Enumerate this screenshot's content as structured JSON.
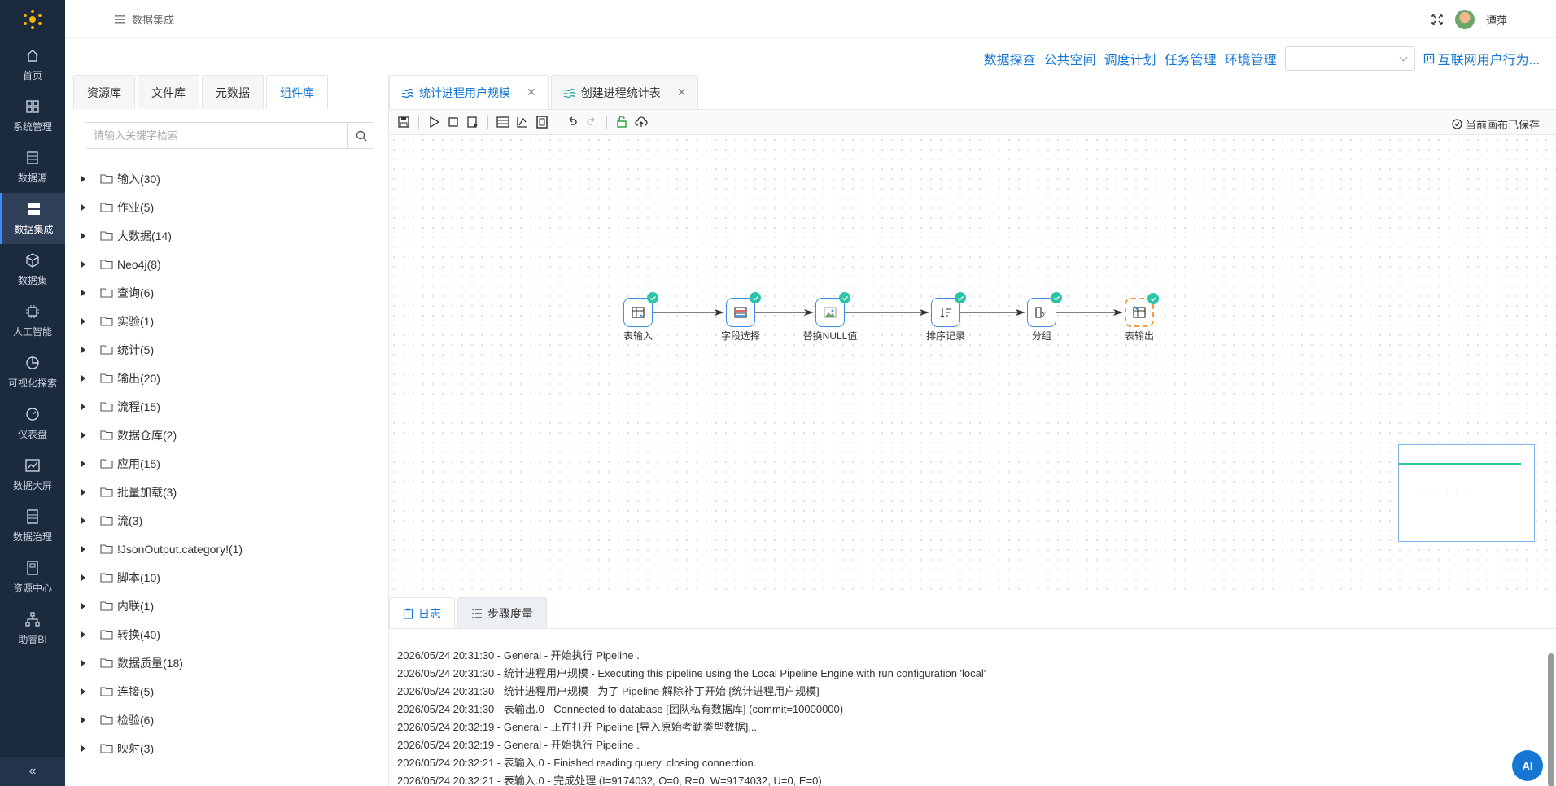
{
  "nav": {
    "items": [
      {
        "label": "首页",
        "icon": "home-icon"
      },
      {
        "label": "系统管理",
        "icon": "grid-icon"
      },
      {
        "label": "数据源",
        "icon": "database-icon"
      },
      {
        "label": "数据集成",
        "icon": "server-icon"
      },
      {
        "label": "数据集",
        "icon": "cube-icon"
      },
      {
        "label": "人工智能",
        "icon": "ai-icon"
      },
      {
        "label": "可视化探索",
        "icon": "pie-chart-icon"
      },
      {
        "label": "仪表盘",
        "icon": "gauge-icon"
      },
      {
        "label": "数据大屏",
        "icon": "line-chart-icon"
      },
      {
        "label": "数据治理",
        "icon": "book-icon"
      },
      {
        "label": "资源中心",
        "icon": "folder-icon"
      },
      {
        "label": "助睿BI",
        "icon": "org-chart-icon"
      }
    ],
    "collapse": "«"
  },
  "header": {
    "breadcrumb": "数据集成",
    "username": "谭萍"
  },
  "toplinks": {
    "items": [
      "数据探查",
      "公共空间",
      "调度计划",
      "任务管理",
      "环境管理"
    ],
    "select_value": "",
    "project": "互联网用户行为..."
  },
  "lpanel": {
    "tabs": [
      "资源库",
      "文件库",
      "元数据",
      "组件库"
    ],
    "search_placeholder": "请输入关键字检索",
    "tree": [
      "输入(30)",
      "作业(5)",
      "大数据(14)",
      "Neo4j(8)",
      "查询(6)",
      "实验(1)",
      "统计(5)",
      "输出(20)",
      "流程(15)",
      "数据仓库(2)",
      "应用(15)",
      "批量加载(3)",
      "流(3)",
      "!JsonOutput.category!(1)",
      "脚本(10)",
      "内联(1)",
      "转换(40)",
      "数据质量(18)",
      "连接(5)",
      "检验(6)",
      "映射(3)"
    ]
  },
  "editor": {
    "tabs": [
      {
        "label": "统计进程用户规模",
        "close": "✕"
      },
      {
        "label": "创建进程统计表",
        "close": "✕"
      }
    ],
    "saved": "当前画布已保存"
  },
  "pipeline": {
    "nodes": [
      {
        "label": "表输入",
        "icon": "table-input-icon"
      },
      {
        "label": "字段选择",
        "icon": "field-select-icon"
      },
      {
        "label": "替换NULL值",
        "icon": "image-placeholder-icon"
      },
      {
        "label": "排序记录",
        "icon": "sort-icon"
      },
      {
        "label": "分组",
        "icon": "group-sum-icon"
      },
      {
        "label": "表输出",
        "icon": "table-output-icon"
      }
    ]
  },
  "bottom": {
    "tabs": [
      "日志",
      "步骤度量"
    ],
    "logs": [
      "2026/05/24 20:31:30 - General - 开始执行 Pipeline .",
      "2026/05/24 20:31:30 - 统计进程用户规模 - Executing this pipeline using the Local Pipeline Engine with run configuration 'local'",
      "2026/05/24 20:31:30 - 统计进程用户规模 - 为了 Pipeline 解除补丁开始 [统计进程用户规模]",
      "2026/05/24 20:31:30 - 表输出.0 - Connected to database [团队私有数据库] (commit=10000000)",
      "2026/05/24 20:32:19 - General - 正在打开 Pipeline [导入原始考勤类型数据]...",
      "2026/05/24 20:32:19 - General - 开始执行 Pipeline .",
      "2026/05/24 20:32:21 - 表输入.0 - Finished reading query, closing connection.",
      "2026/05/24 20:32:21 - 表输入.0 - 完成处理 (I=9174032, O=0, R=0, W=9174032, U=0, E=0)"
    ],
    "ai_label": "AI"
  },
  "colors": {
    "nav_bg": "#1c2a3e",
    "accent": "#1677d2",
    "success": "#2cc4a8",
    "selected": "#f29b38"
  }
}
